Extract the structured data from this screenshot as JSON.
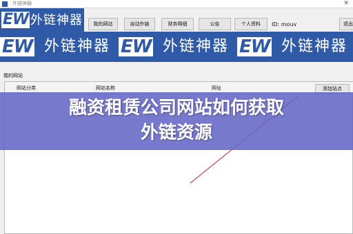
{
  "window": {
    "title": "外链神器",
    "close_glyph": "✕"
  },
  "logo": {
    "mark": "EW",
    "text": "外链神器"
  },
  "nav": {
    "tabs": [
      {
        "label": "我的网站"
      },
      {
        "label": "自动外链"
      },
      {
        "label": "财务明细"
      },
      {
        "label": "公告"
      },
      {
        "label": "个人资料"
      }
    ],
    "user_id": "ID: mouv",
    "exit_label": "退出"
  },
  "banner": {
    "mark": "EW",
    "text": "外链神器"
  },
  "section": {
    "title": "我的网站"
  },
  "table": {
    "columns": [
      "网站分类",
      "网站名称",
      "网址"
    ],
    "add_button": "添加站点"
  },
  "overlay": {
    "line1": "融资租赁公司网站如何获取",
    "line2": "外链资源"
  },
  "colors": {
    "brand_blue": "#2f5aa8",
    "overlay": "#6466c6",
    "accent_line": "#d1404b"
  }
}
